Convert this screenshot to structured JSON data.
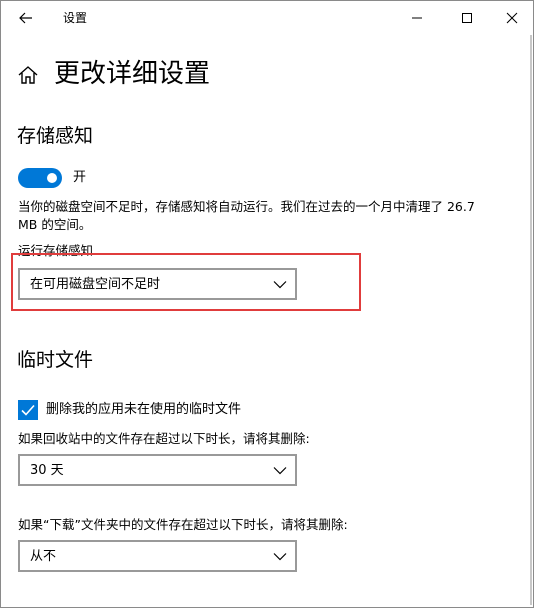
{
  "window": {
    "title": "设置",
    "back_icon": "back-arrow-icon",
    "minimize_icon": "minimize-icon",
    "maximize_icon": "maximize-icon",
    "close_icon": "close-icon"
  },
  "page": {
    "home_icon": "home-icon",
    "title": "更改详细设置"
  },
  "storage_sense": {
    "heading": "存储感知",
    "toggle_state": "开",
    "toggle_on": true,
    "description": "当你的磁盘空间不足时，存储感知将自动运行。我们在过去的一个月中清理了 26.7 MB 的空间。",
    "run_label": "运行存储感知",
    "run_value": "在可用磁盘空间不足时"
  },
  "temp_files": {
    "heading": "临时文件",
    "checkbox_label": "删除我的应用未在使用的临时文件",
    "checkbox_checked": true,
    "recycle_label": "如果回收站中的文件存在超过以下时长，请将其删除:",
    "recycle_value": "30 天",
    "download_label": "如果“下载”文件夹中的文件存在超过以下时长，请将其删除:",
    "download_value": "从不"
  },
  "colors": {
    "accent": "#0078d7",
    "highlight": "#e03c3c",
    "border": "#999999"
  }
}
